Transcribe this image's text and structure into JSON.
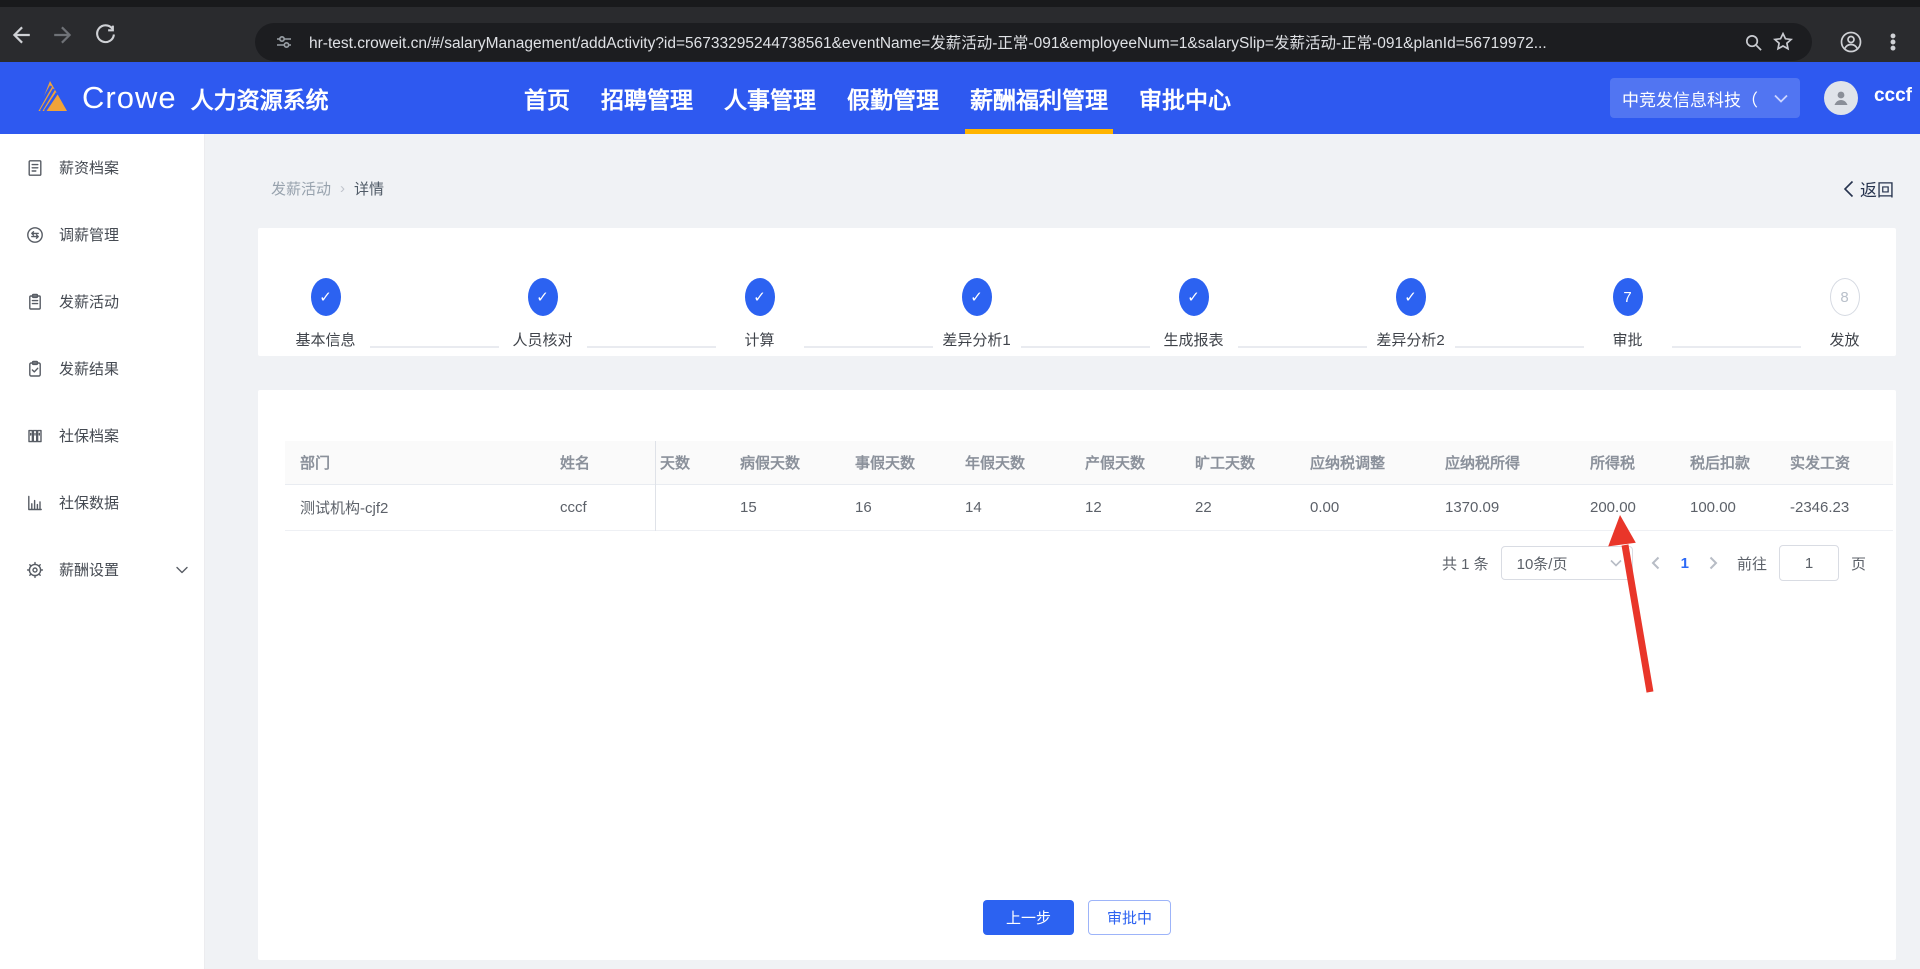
{
  "browser": {
    "url": "hr-test.croweit.cn/#/salaryManagement/addActivity?id=56733295244738561&eventName=发薪活动-正常-091&employeeNum=1&salarySlip=发薪活动-正常-091&planId=56719972..."
  },
  "header": {
    "brand": "Crowe",
    "app_title": "人力资源系统",
    "nav": [
      {
        "label": "首页",
        "active": false
      },
      {
        "label": "招聘管理",
        "active": false
      },
      {
        "label": "人事管理",
        "active": false
      },
      {
        "label": "假勤管理",
        "active": false
      },
      {
        "label": "薪酬福利管理",
        "active": true
      },
      {
        "label": "审批中心",
        "active": false
      }
    ],
    "company": "中竞发信息科技（",
    "username": "cccf"
  },
  "sidebar": {
    "items": [
      {
        "label": "薪资档案",
        "icon": "salary-archive-icon"
      },
      {
        "label": "调薪管理",
        "icon": "salary-adjust-icon"
      },
      {
        "label": "发薪活动",
        "icon": "payroll-activity-icon"
      },
      {
        "label": "发薪结果",
        "icon": "payroll-result-icon"
      },
      {
        "label": "社保档案",
        "icon": "social-security-archive-icon"
      },
      {
        "label": "社保数据",
        "icon": "social-security-data-icon"
      },
      {
        "label": "薪酬设置",
        "icon": "salary-settings-icon",
        "expandable": true
      }
    ]
  },
  "breadcrumb": {
    "parent": "发薪活动",
    "separator": "›",
    "current": "详情",
    "back": "返回"
  },
  "stepper": {
    "steps": [
      {
        "label": "基本信息",
        "state": "done",
        "mark": "✓"
      },
      {
        "label": "人员核对",
        "state": "done",
        "mark": "✓"
      },
      {
        "label": "计算",
        "state": "done",
        "mark": "✓"
      },
      {
        "label": "差异分析1",
        "state": "done",
        "mark": "✓"
      },
      {
        "label": "生成报表",
        "state": "done",
        "mark": "✓"
      },
      {
        "label": "差异分析2",
        "state": "done",
        "mark": "✓"
      },
      {
        "label": "审批",
        "state": "current",
        "mark": "7"
      },
      {
        "label": "发放",
        "state": "pending",
        "mark": "8"
      }
    ]
  },
  "table": {
    "columns": [
      "部门",
      "姓名",
      "天数",
      "病假天数",
      "事假天数",
      "年假天数",
      "产假天数",
      "旷工天数",
      "应纳税调整",
      "应纳税所得",
      "所得税",
      "税后扣款",
      "实发工资"
    ],
    "rows": [
      [
        "测试机构-cjf2",
        "cccf",
        "",
        "15",
        "16",
        "14",
        "12",
        "22",
        "0.00",
        "1370.09",
        "200.00",
        "100.00",
        "-2346.23"
      ]
    ]
  },
  "pagination": {
    "total": "共 1 条",
    "page_size": "10条/页",
    "page": "1",
    "goto_label": "前往",
    "goto_value": "1",
    "unit": "页"
  },
  "actions": {
    "prev_step": "上一步",
    "status": "审批中"
  },
  "annotation": {
    "red_arrow_points_at": "所得税 200.00"
  },
  "colors": {
    "header_blue": "#2e59f0",
    "accent_yellow": "#ffb400",
    "step_blue": "#2c62f1",
    "link_blue": "#2d6af6",
    "arrow_red": "#e9362a",
    "logo_gold": "#f0a338"
  }
}
